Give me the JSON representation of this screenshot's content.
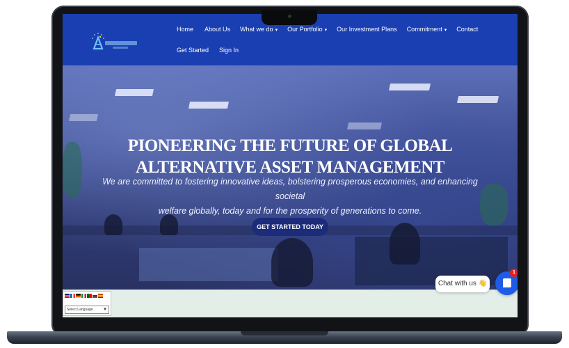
{
  "nav": {
    "items": [
      {
        "label": "Home",
        "caret": false
      },
      {
        "label": "About Us",
        "caret": false
      },
      {
        "label": "What we do",
        "caret": true
      },
      {
        "label": "Our Portfolio",
        "caret": true
      },
      {
        "label": "Our Investment Plans",
        "caret": false
      },
      {
        "label": "Commitment",
        "caret": true
      },
      {
        "label": "Contact",
        "caret": false
      }
    ],
    "row2": [
      {
        "label": "Get Started"
      },
      {
        "label": "Sign In"
      }
    ],
    "caret_glyph": "▾"
  },
  "hero": {
    "title_line1": "PIONEERING THE FUTURE OF GLOBAL",
    "title_line2": "ALTERNATIVE ASSET MANAGEMENT",
    "subtitle_line1": "We are committed to fostering innovative ideas, bolstering prosperous economies, and enhancing societal",
    "subtitle_line2": "welfare globally, today and for the prosperity of generations to come.",
    "cta": "GET STARTED TODAY"
  },
  "language": {
    "selected": "Select Language"
  },
  "chat": {
    "label": "Chat with us 👋",
    "badge": "1"
  },
  "colors": {
    "navbar": "#1a3fb2",
    "cta": "#1c2b7a",
    "chat_button": "#1e5be6",
    "badge": "#e02020"
  },
  "icons": {
    "logo": "brand-logo",
    "chat": "chat-icon",
    "flags": [
      "flag-uk",
      "flag-fr",
      "flag-de",
      "flag-it",
      "flag-pt",
      "flag-ru",
      "flag-es"
    ]
  }
}
